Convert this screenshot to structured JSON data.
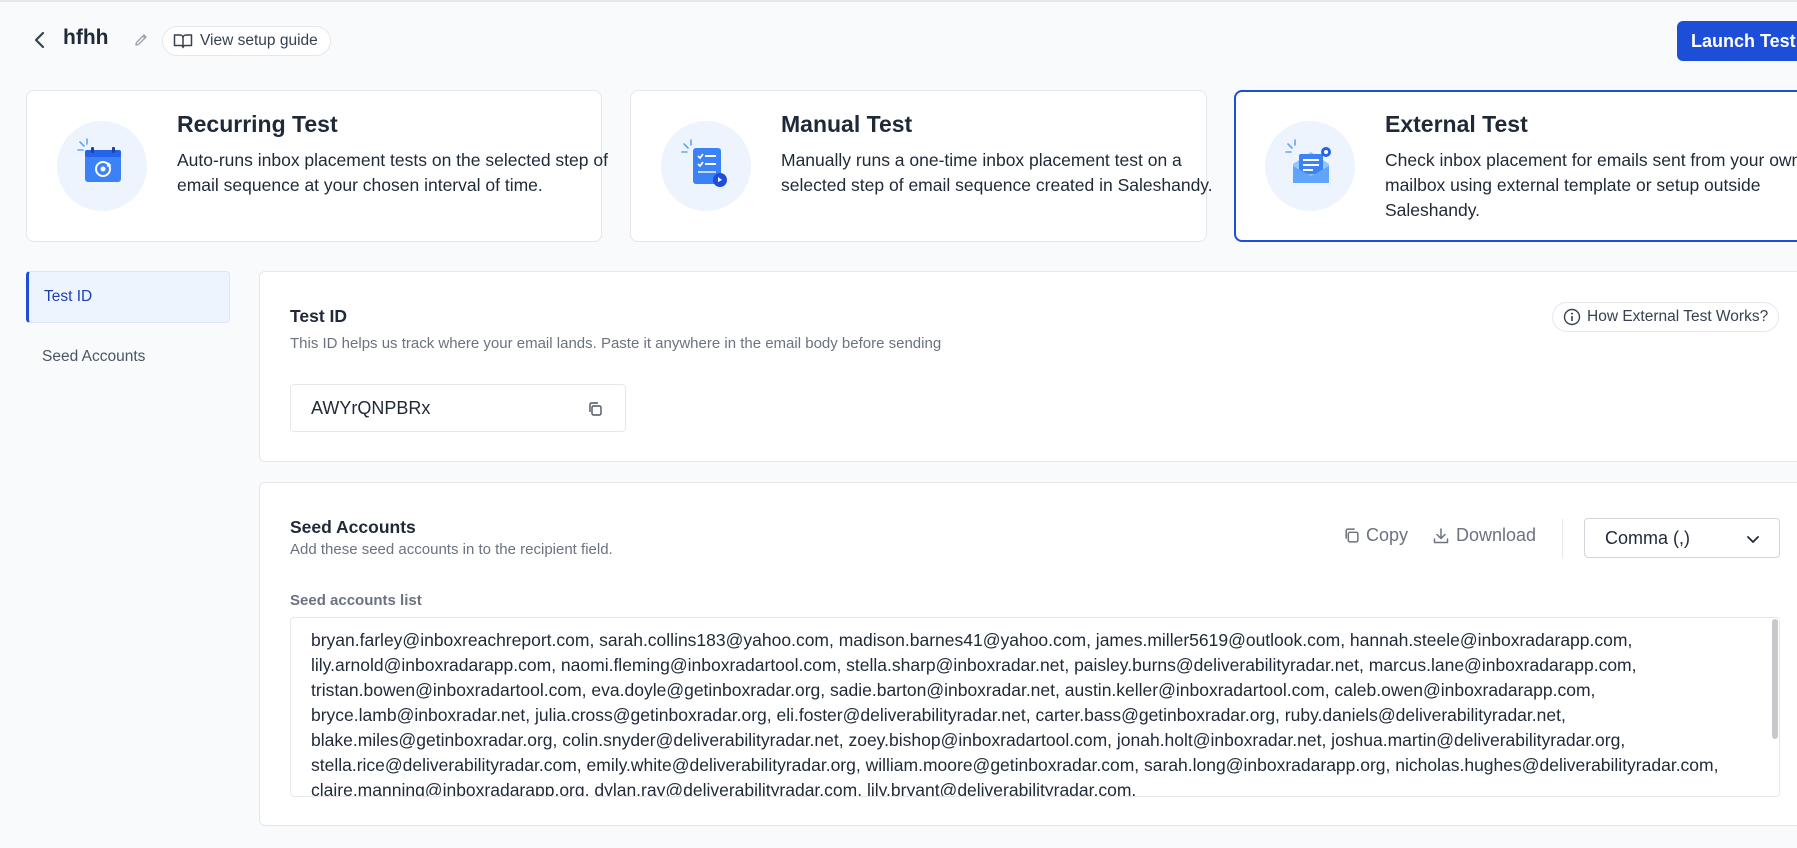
{
  "header": {
    "title": "hfhh",
    "guide_label": "View setup guide",
    "launch_label": "Launch Test"
  },
  "cards": [
    {
      "title": "Recurring Test",
      "description": "Auto-runs inbox placement tests on the selected step of email sequence at your chosen interval of time."
    },
    {
      "title": "Manual Test",
      "description": "Manually runs a one-time inbox placement test on a selected step of email sequence created in Saleshandy."
    },
    {
      "title": "External Test",
      "description": "Check inbox placement for emails sent from your own mailbox using external template or setup outside Saleshandy."
    }
  ],
  "nav": [
    {
      "label": "Test ID"
    },
    {
      "label": "Seed Accounts"
    }
  ],
  "test_id": {
    "title": "Test ID",
    "subtitle": "This ID helps us track where your email lands. Paste it anywhere in the email body before sending",
    "how_label": "How External Test Works?",
    "value": "AWYrQNPBRx"
  },
  "seed": {
    "title": "Seed Accounts",
    "subtitle": "Add these seed accounts in to the recipient field.",
    "copy_label": "Copy",
    "download_label": "Download",
    "separator_selected": "Comma (,)",
    "list_label": "Seed accounts list",
    "list_text": "bryan.farley@inboxreachreport.com, sarah.collins183@yahoo.com, madison.barnes41@yahoo.com, james.miller5619@outlook.com, hannah.steele@inboxradarapp.com, lily.arnold@inboxradarapp.com, naomi.fleming@inboxradartool.com, stella.sharp@inboxradar.net, paisley.burns@deliverabilityradar.net, marcus.lane@inboxradarapp.com, tristan.bowen@inboxradartool.com, eva.doyle@getinboxradar.org, sadie.barton@inboxradar.net, austin.keller@inboxradartool.com, caleb.owen@inboxradarapp.com, bryce.lamb@inboxradar.net, julia.cross@getinboxradar.org, eli.foster@deliverabilityradar.net, carter.bass@getinboxradar.org, ruby.daniels@deliverabilityradar.net, blake.miles@getinboxradar.org, colin.snyder@deliverabilityradar.net, zoey.bishop@inboxradartool.com, jonah.holt@inboxradar.net, joshua.martin@deliverabilityradar.org, stella.rice@deliverabilityradar.com, emily.white@deliverabilityradar.org, william.moore@getinboxradar.com, sarah.long@inboxradarapp.org, nicholas.hughes@deliverabilityradar.com, claire.manning@inboxradarapp.org, dylan.ray@deliverabilityradar.com, lily.bryant@deliverabilityradar.com,"
  },
  "colors": {
    "accent": "#1d4ed8",
    "icon_bg": "#eef4fd",
    "icon_blue": "#3b82f6"
  }
}
